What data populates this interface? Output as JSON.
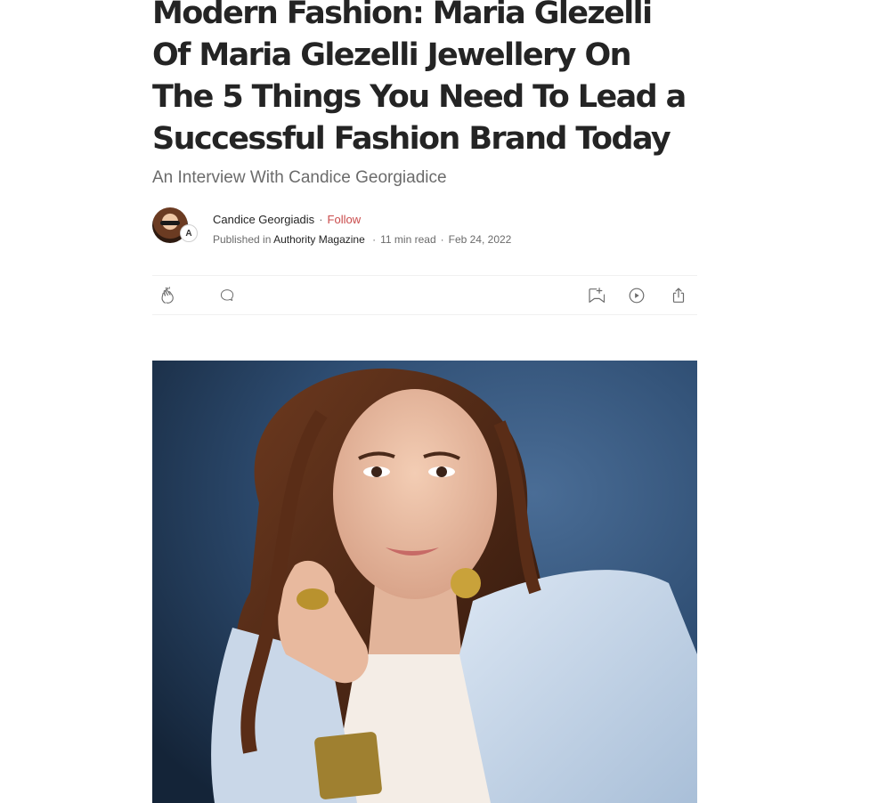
{
  "article": {
    "title": "Modern Fashion: Maria Glezelli Of Maria Glezelli Jewellery On The 5 Things You Need To Lead a Successful Fashion Brand Today",
    "subtitle": "An Interview With Candice Georgiadice"
  },
  "byline": {
    "author": "Candice Georgiadis",
    "separator": "·",
    "follow_label": "Follow",
    "published_in_label": "Published in",
    "publication": "Authority Magazine",
    "read_time": "11 min read",
    "date": "Feb 24, 2022",
    "publication_badge_letter": "A"
  },
  "actions": {
    "icons": [
      "clap-icon",
      "comment-icon",
      "bookmark-add-icon",
      "play-icon",
      "share-icon"
    ]
  },
  "hero_image": {
    "alt": "Portrait of a woman with curly hair wearing a light blue blazer and gold jewellery"
  },
  "colors": {
    "text": "#242424",
    "muted": "#6b6b6b",
    "follow": "#c94a4a",
    "divider": "#f0f0f0"
  }
}
